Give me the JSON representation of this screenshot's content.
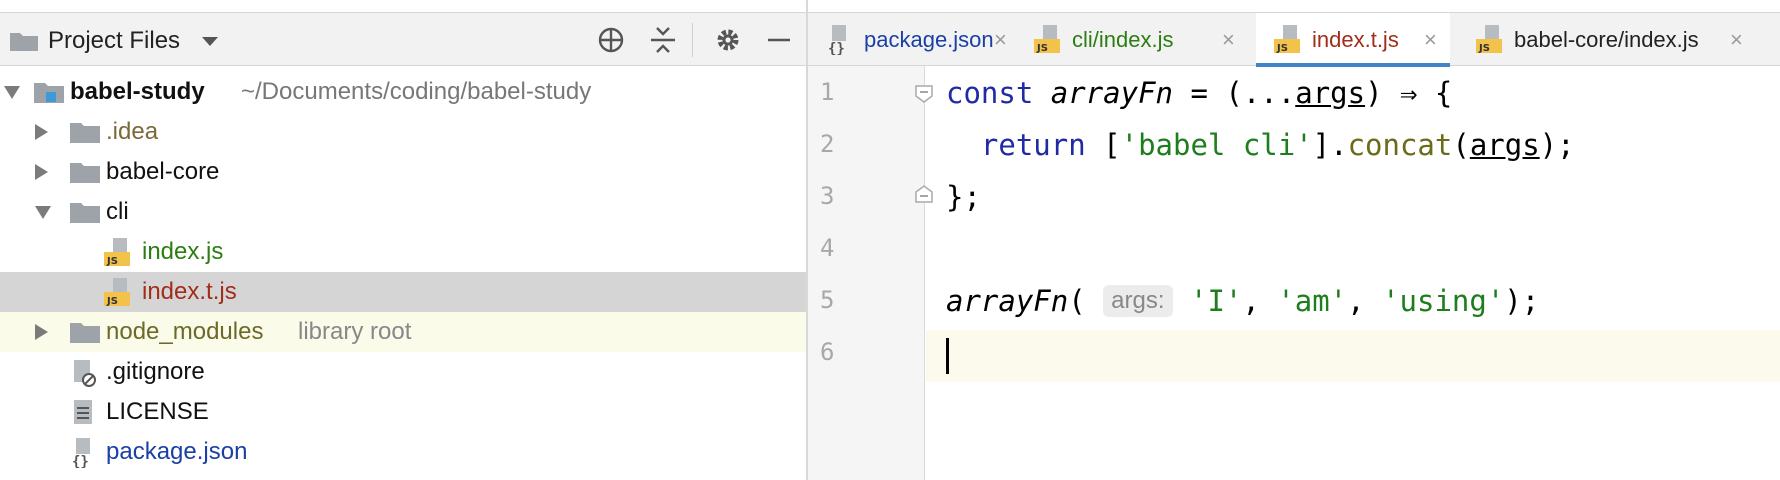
{
  "project_panel": {
    "title": "Project Files",
    "icons": [
      "locate-icon",
      "collapse-all-icon",
      "gear-icon",
      "minimize-icon"
    ]
  },
  "tree": {
    "root": {
      "name": "babel-study",
      "path": "~/Documents/coding/babel-study"
    },
    "items": [
      {
        "label": ".idea",
        "type": "folder",
        "expanded": false
      },
      {
        "label": "babel-core",
        "type": "folder",
        "expanded": false
      },
      {
        "label": "cli",
        "type": "folder",
        "expanded": true
      },
      {
        "label": "index.js",
        "type": "js-file"
      },
      {
        "label": "index.t.js",
        "type": "js-file",
        "selected": true
      },
      {
        "label": "node_modules",
        "suffix": "library root",
        "type": "folder",
        "expanded": false
      },
      {
        "label": ".gitignore",
        "type": "ignore-file"
      },
      {
        "label": "LICENSE",
        "type": "text-file"
      },
      {
        "label": "package.json",
        "type": "json-file"
      }
    ]
  },
  "tabs": [
    {
      "label": "package.json",
      "icon": "json-file-icon",
      "active": false
    },
    {
      "label": "cli/index.js",
      "icon": "js-file-icon",
      "active": false
    },
    {
      "label": "index.t.js",
      "icon": "js-file-icon",
      "active": true
    },
    {
      "label": "babel-core/index.js",
      "icon": "js-file-icon",
      "active": false
    }
  ],
  "tab_close_glyph": "×",
  "editor": {
    "line_numbers": [
      "1",
      "2",
      "3",
      "4",
      "5",
      "6"
    ],
    "current_line": 6,
    "code": {
      "l1": {
        "kw": "const",
        "name": "arrayFn",
        "eq": " = (",
        "spread": "...",
        "param": "args",
        "arrow": ") ⇒ {"
      },
      "l2": {
        "kw": "return",
        "open": " [",
        "str": "'babel cli'",
        "close": "].",
        "meth": "concat",
        "paren": "(",
        "param": "args",
        "end": ");"
      },
      "l3": {
        "text": "};"
      },
      "l5": {
        "name": "arrayFn",
        "paren": "(",
        "hint": "args:",
        "s1": "'I'",
        "c1": ", ",
        "s2": "'am'",
        "c2": ", ",
        "s3": "'using'",
        "end": ");"
      }
    }
  },
  "colors": {
    "accent": "#4083c9",
    "selected_row": "#d5d5d5",
    "library_row": "#fbfbe9",
    "keyword": "#1f2aa3",
    "string": "#1e7e1e",
    "method": "#6b6b1a",
    "modified_file": "#a02e1a",
    "new_file": "#2c7d12"
  }
}
